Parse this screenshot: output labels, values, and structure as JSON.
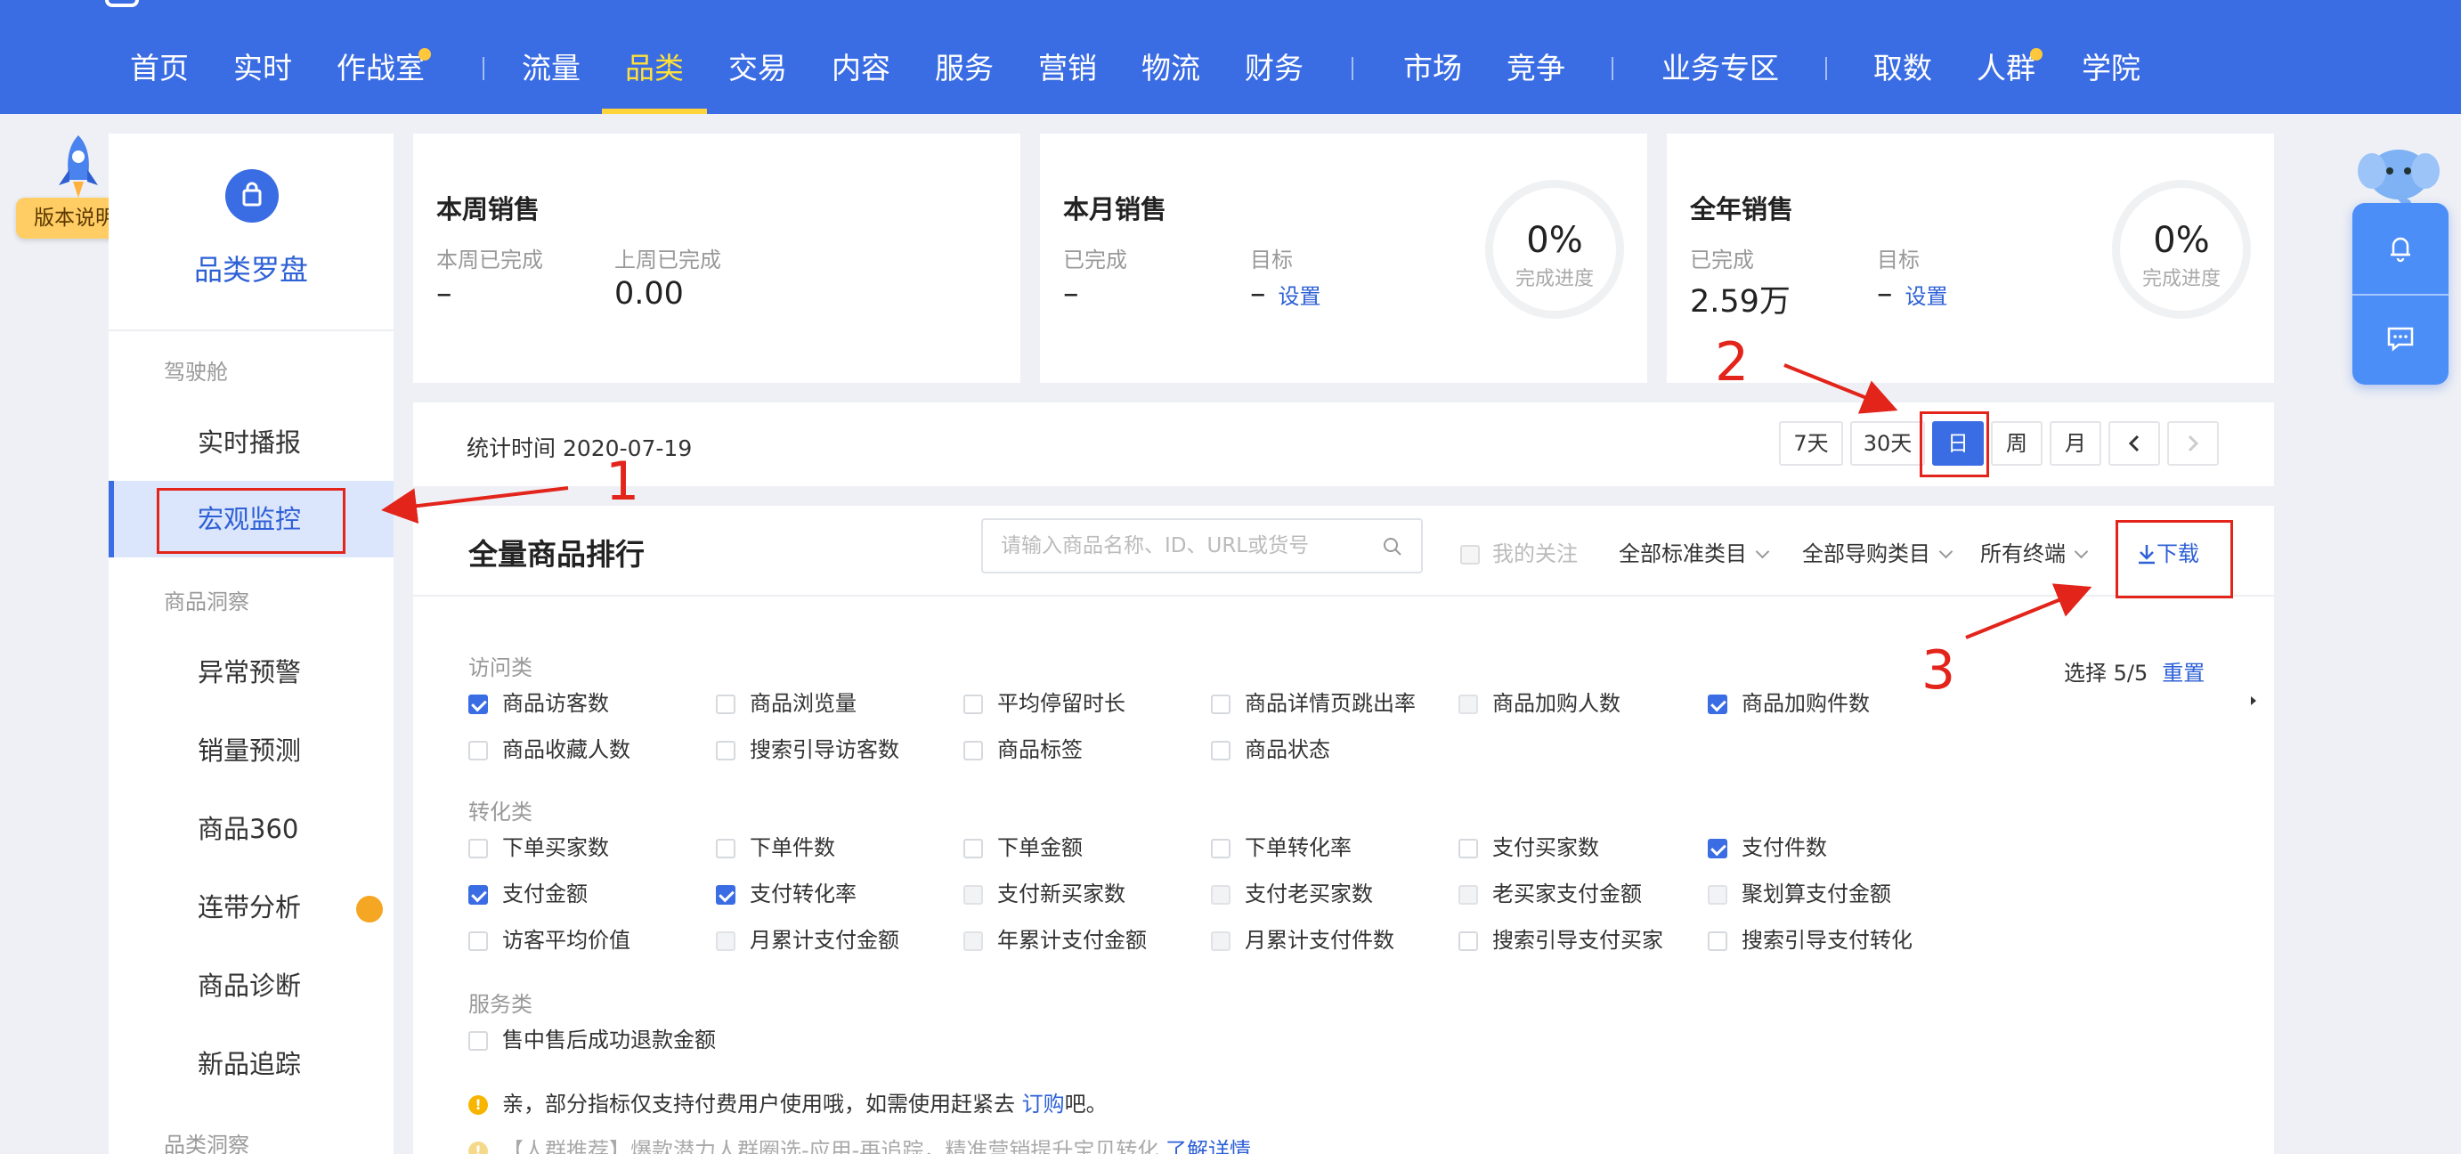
{
  "nav": {
    "items": [
      "首页",
      "实时",
      "作战室",
      "流量",
      "品类",
      "交易",
      "内容",
      "服务",
      "营销",
      "物流",
      "财务",
      "市场",
      "竞争",
      "业务专区",
      "取数",
      "人群",
      "学院"
    ],
    "active": "品类",
    "accent_color": "#3a6ce3",
    "active_color": "#ffe03b"
  },
  "version_tag": "版本说明",
  "sidebar": {
    "brand": "品类罗盘",
    "groups": [
      "驾驶舱",
      "商品洞察",
      "品类洞察"
    ],
    "items": [
      "实时播报",
      "宏观监控",
      "异常预警",
      "销量预测",
      "商品360",
      "连带分析",
      "商品诊断",
      "新品追踪"
    ],
    "active_item": "宏观监控"
  },
  "cards": {
    "week": {
      "title": "本周销售",
      "label1": "本周已完成",
      "value1": "–",
      "label2": "上周已完成",
      "value2": "0.00"
    },
    "month": {
      "title": "本月销售",
      "label1": "已完成",
      "value1": "–",
      "label2": "目标",
      "value2": "–",
      "link": "设置",
      "pct": "0%",
      "pct_caption": "完成进度"
    },
    "year": {
      "title": "全年销售",
      "label1": "已完成",
      "value1": "2.59万",
      "label2": "目标",
      "value2": "–",
      "link": "设置",
      "pct": "0%",
      "pct_caption": "完成进度"
    }
  },
  "timebar": {
    "stat_time": "统计时间 2020-07-19",
    "buttons": [
      "7天",
      "30天",
      "日",
      "周",
      "月"
    ],
    "active": "日"
  },
  "ranking": {
    "title": "全量商品排行",
    "search_placeholder": "请输入商品名称、ID、URL或货号",
    "follow_label": "我的关注",
    "dropdowns": [
      "全部标准类目",
      "全部导购类目",
      "所有终端"
    ],
    "download": "下载",
    "select_count": "选择 5/5",
    "reset": "重置",
    "categories": [
      {
        "label": "访问类",
        "rows": [
          [
            {
              "text": "商品访客数",
              "state": "checked"
            },
            {
              "text": "商品浏览量",
              "state": "unchecked"
            },
            {
              "text": "平均停留时长",
              "state": "unchecked"
            },
            {
              "text": "商品详情页跳出率",
              "state": "unchecked"
            },
            {
              "text": "商品加购人数",
              "state": "disabled"
            },
            {
              "text": "商品加购件数",
              "state": "checked"
            }
          ],
          [
            {
              "text": "商品收藏人数",
              "state": "unchecked"
            },
            {
              "text": "搜索引导访客数",
              "state": "unchecked"
            },
            {
              "text": "商品标签",
              "state": "unchecked"
            },
            {
              "text": "商品状态",
              "state": "unchecked"
            }
          ]
        ]
      },
      {
        "label": "转化类",
        "rows": [
          [
            {
              "text": "下单买家数",
              "state": "unchecked"
            },
            {
              "text": "下单件数",
              "state": "unchecked"
            },
            {
              "text": "下单金额",
              "state": "unchecked"
            },
            {
              "text": "下单转化率",
              "state": "unchecked"
            },
            {
              "text": "支付买家数",
              "state": "unchecked"
            },
            {
              "text": "支付件数",
              "state": "checked"
            }
          ],
          [
            {
              "text": "支付金额",
              "state": "checked"
            },
            {
              "text": "支付转化率",
              "state": "checked"
            },
            {
              "text": "支付新买家数",
              "state": "disabled"
            },
            {
              "text": "支付老买家数",
              "state": "disabled"
            },
            {
              "text": "老买家支付金额",
              "state": "disabled"
            },
            {
              "text": "聚划算支付金额",
              "state": "disabled"
            }
          ],
          [
            {
              "text": "访客平均价值",
              "state": "unchecked"
            },
            {
              "text": "月累计支付金额",
              "state": "disabled"
            },
            {
              "text": "年累计支付金额",
              "state": "disabled"
            },
            {
              "text": "月累计支付件数",
              "state": "disabled"
            },
            {
              "text": "搜索引导支付买家",
              "state": "unchecked"
            },
            {
              "text": "搜索引导支付转化",
              "state": "unchecked"
            }
          ]
        ]
      },
      {
        "label": "服务类",
        "rows": [
          [
            {
              "text": "售中售后成功退款金额",
              "state": "unchecked"
            }
          ]
        ]
      }
    ],
    "notice1": {
      "prefix": "亲，部分指标仅支持付费用户使用哦，如需使用赶紧去 ",
      "link": "订购",
      "suffix": "吧。"
    },
    "notice2": {
      "text": "【人群推荐】爆款潜力人群圈选-应用-再追踪，精准营销提升宝贝转化 ",
      "link": "了解详情"
    }
  },
  "annotations": [
    "1",
    "2",
    "3"
  ],
  "colors": {
    "primary": "#3a6ce3",
    "annotation": "#e2241b",
    "warning": "#f5a623"
  }
}
